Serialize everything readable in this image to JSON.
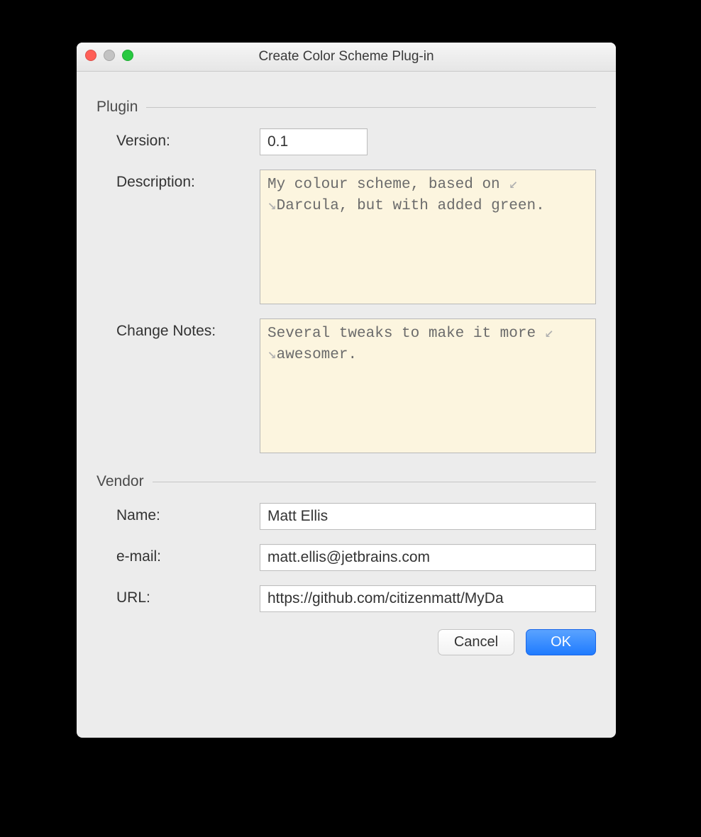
{
  "window": {
    "title": "Create Color Scheme Plug-in"
  },
  "sections": {
    "plugin_label": "Plugin",
    "vendor_label": "Vendor"
  },
  "plugin": {
    "version_label": "Version:",
    "version_value": "0.1",
    "description_label": "Description:",
    "description_value": "My colour scheme, based on Darcula, but with added green.",
    "description_line1": "My colour scheme, based on ",
    "description_line2": "Darcula, but with added green.",
    "change_notes_label": "Change Notes:",
    "change_notes_value": "Several tweaks to make it more awesomer.",
    "change_notes_line1": "Several tweaks to make it more ",
    "change_notes_line2": "awesomer."
  },
  "vendor": {
    "name_label": "Name:",
    "name_value": "Matt Ellis",
    "email_label": "e-mail:",
    "email_value": "matt.ellis@jetbrains.com",
    "url_label": "URL:",
    "url_value": "https://github.com/citizenmatt/MyDa"
  },
  "buttons": {
    "cancel": "Cancel",
    "ok": "OK"
  },
  "glyphs": {
    "wrap_out": "↙",
    "wrap_in": "↘"
  }
}
